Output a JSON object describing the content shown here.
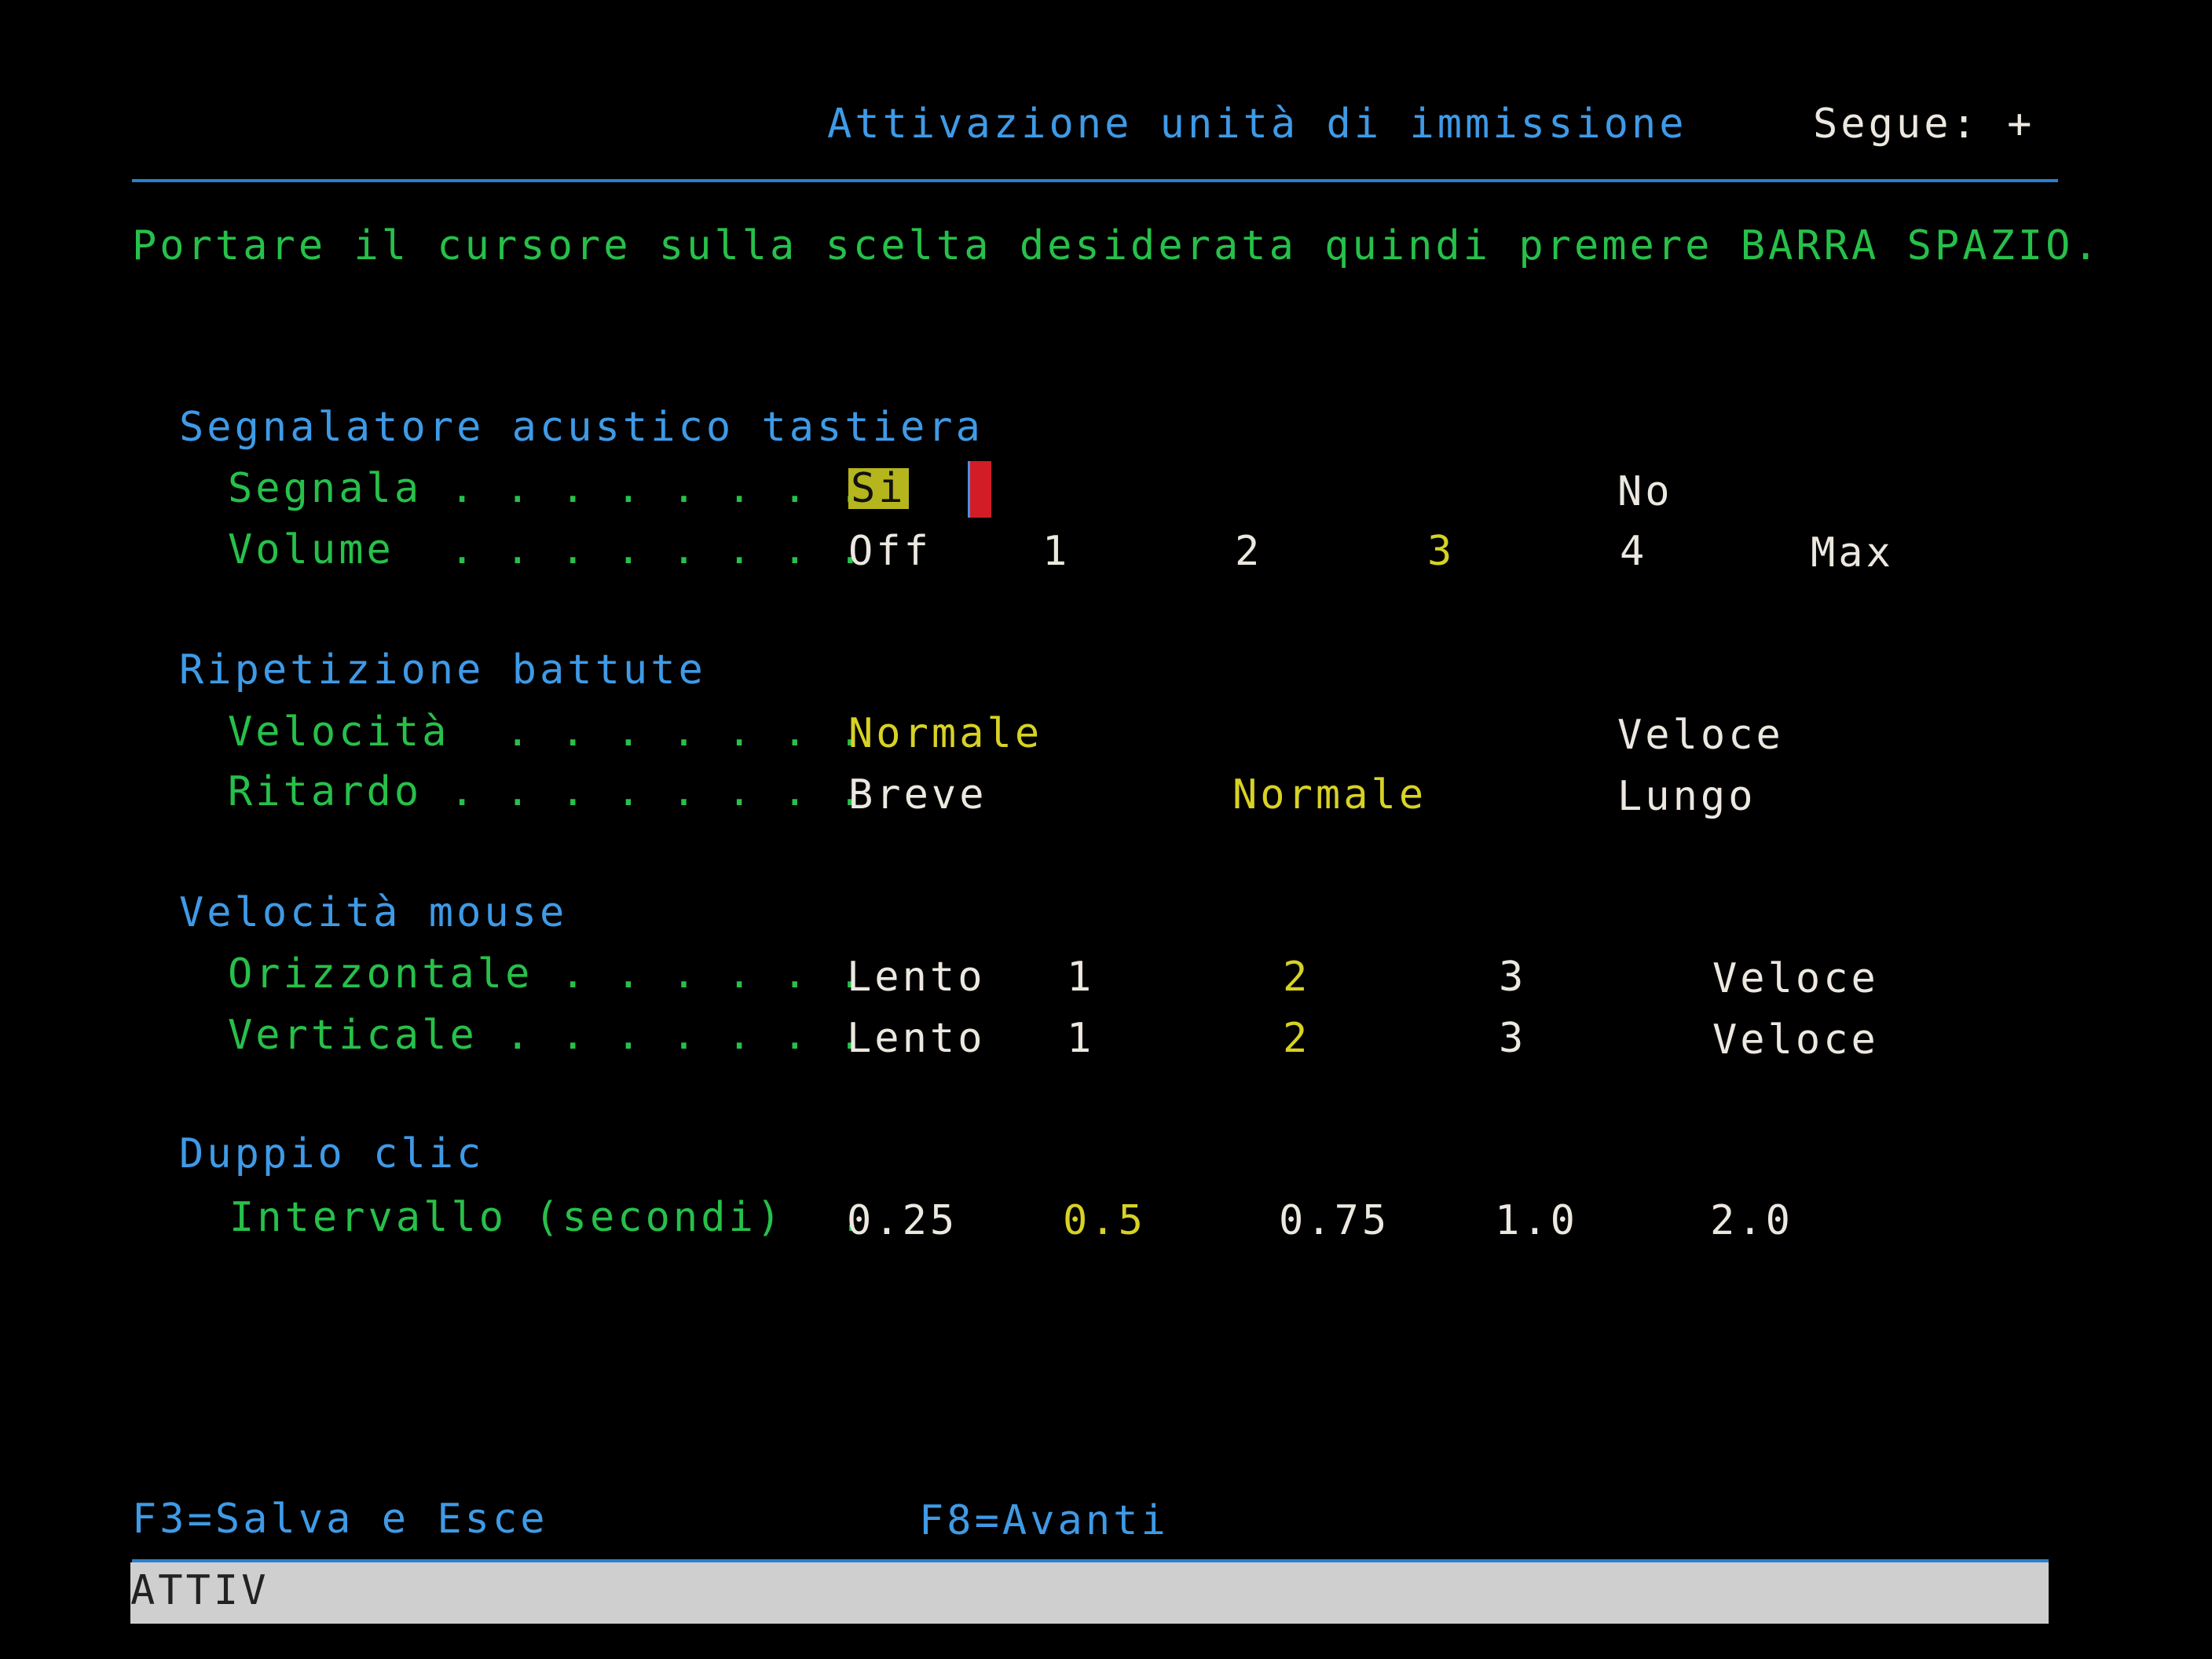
{
  "header": {
    "title": "Attivazione unità di immissione",
    "more": "Segue: +"
  },
  "instructions": "Portare il cursore sulla scelta desiderata quindi premere BARRA SPAZIO.",
  "sections": {
    "keyboard_beep": {
      "heading": "Segnalatore acustico tastiera",
      "signal": {
        "label": "Segnala . . . . . . . .",
        "options": [
          "Si",
          "No"
        ],
        "selected": "Si"
      },
      "volume": {
        "label": "Volume  . . . . . . . .",
        "options": [
          "Off",
          "1",
          "2",
          "3",
          "4",
          "Max"
        ],
        "selected": "3"
      }
    },
    "key_repeat": {
      "heading": "Ripetizione battute",
      "speed": {
        "label": "Velocità  . . . . . . .",
        "options": [
          "Normale",
          "Veloce"
        ],
        "selected": "Normale"
      },
      "delay": {
        "label": "Ritardo . . . . . . . .",
        "options": [
          "Breve",
          "Normale",
          "Lungo"
        ],
        "selected": "Normale"
      }
    },
    "mouse_speed": {
      "heading": "Velocità mouse",
      "horizontal": {
        "label": "Orizzontale . . . . . .",
        "options": [
          "Lento",
          "1",
          "2",
          "3",
          "Veloce"
        ],
        "selected": "2"
      },
      "vertical": {
        "label": "Verticale . . . . . . .",
        "options": [
          "Lento",
          "1",
          "2",
          "3",
          "Veloce"
        ],
        "selected": "2"
      }
    },
    "double_click": {
      "heading": "Duppio clic",
      "interval": {
        "label": "Intervallo (secondi)  .",
        "options": [
          "0.25",
          "0.5",
          "0.75",
          "1.0",
          "2.0"
        ],
        "selected": "0.5"
      }
    }
  },
  "function_keys": {
    "f3": "F3=Salva e Esce",
    "f8": "F8=Avanti"
  },
  "status_bar": {
    "text": "ATTIV"
  },
  "colors": {
    "background": "#000000",
    "heading": "#3f9ae6",
    "label": "#27c04a",
    "option": "#ece8e0",
    "selected": "#d7d224",
    "cursor": "#d21c26",
    "status_bar": "#cfcfcf"
  }
}
